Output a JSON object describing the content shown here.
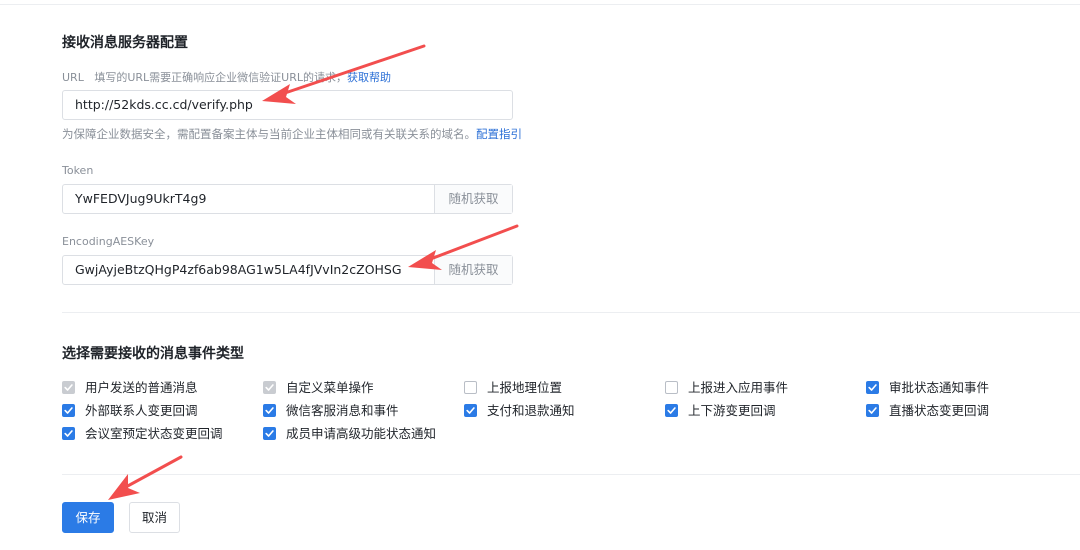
{
  "server_config": {
    "title": "接收消息服务器配置",
    "url_label": "URL",
    "url_description": "填写的URL需要正确响应企业微信验证URL的请求，",
    "url_help_link": "获取帮助",
    "url_value": "http://52kds.cc.cd/verify.php",
    "url_hint": "为保障企业数据安全，需配置备案主体与当前企业主体相同或有关联关系的域名。",
    "url_guide_link": "配置指引",
    "token_label": "Token",
    "token_value": "YwFEDVJug9UkrT4g9",
    "token_random_button": "随机获取",
    "aes_label": "EncodingAESKey",
    "aes_value": "GwjAyjeBtzQHgP4zf6ab98AG1w5LA4fJVvIn2cZOHSG",
    "aes_random_button": "随机获取"
  },
  "events": {
    "title": "选择需要接收的消息事件类型",
    "items": [
      {
        "label": "用户发送的普通消息",
        "state": "checked-disabled"
      },
      {
        "label": "自定义菜单操作",
        "state": "checked-disabled"
      },
      {
        "label": "上报地理位置",
        "state": "unchecked"
      },
      {
        "label": "上报进入应用事件",
        "state": "unchecked"
      },
      {
        "label": "审批状态通知事件",
        "state": "checked"
      },
      {
        "label": "外部联系人变更回调",
        "state": "checked"
      },
      {
        "label": "微信客服消息和事件",
        "state": "checked"
      },
      {
        "label": "支付和退款通知",
        "state": "checked"
      },
      {
        "label": "上下游变更回调",
        "state": "checked"
      },
      {
        "label": "直播状态变更回调",
        "state": "checked"
      },
      {
        "label": "会议室预定状态变更回调",
        "state": "checked"
      },
      {
        "label": "成员申请高级功能状态通知",
        "state": "checked"
      }
    ]
  },
  "actions": {
    "save_label": "保存",
    "cancel_label": "取消"
  },
  "colors": {
    "primary": "#2b7be6",
    "link": "#2b6fd6",
    "annotation_arrow": "#f24e4e"
  }
}
